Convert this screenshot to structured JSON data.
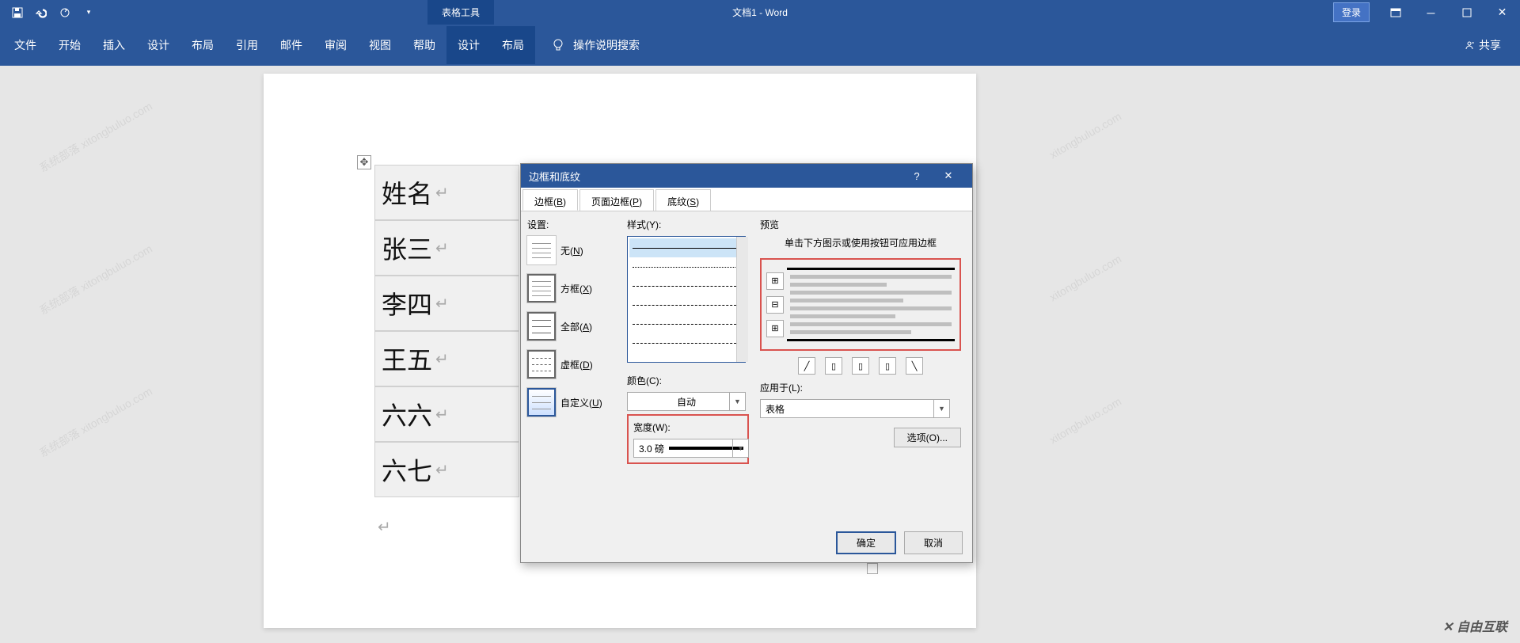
{
  "titlebar": {
    "table_tools": "表格工具",
    "doc_title": "文档1 - Word",
    "login": "登录"
  },
  "ribbon": {
    "tabs": [
      "文件",
      "开始",
      "插入",
      "设计",
      "布局",
      "引用",
      "邮件",
      "审阅",
      "视图",
      "帮助"
    ],
    "ctx_tabs": [
      "设计",
      "布局"
    ],
    "help_search": "操作说明搜索",
    "share": "共享"
  },
  "table_cells": [
    "姓名",
    "张三",
    "李四",
    "王五",
    "六六",
    "六七"
  ],
  "dialog": {
    "title": "边框和底纹",
    "tabs": [
      {
        "label": "边框",
        "accel": "B"
      },
      {
        "label": "页面边框",
        "accel": "P"
      },
      {
        "label": "底纹",
        "accel": "S"
      }
    ],
    "settings_label": "设置:",
    "settings": [
      {
        "label": "无",
        "accel": "N"
      },
      {
        "label": "方框",
        "accel": "X"
      },
      {
        "label": "全部",
        "accel": "A"
      },
      {
        "label": "虚框",
        "accel": "D"
      },
      {
        "label": "自定义",
        "accel": "U"
      }
    ],
    "style_label": "样式(Y):",
    "color_label": "颜色(C):",
    "color_value": "自动",
    "width_label": "宽度(W):",
    "width_value": "3.0 磅",
    "preview_label": "预览",
    "preview_hint": "单击下方图示或使用按钮可应用边框",
    "apply_label": "应用于(L):",
    "apply_value": "表格",
    "options_btn": "选项(O)...",
    "ok": "确定",
    "cancel": "取消"
  },
  "brand": "自由互联"
}
